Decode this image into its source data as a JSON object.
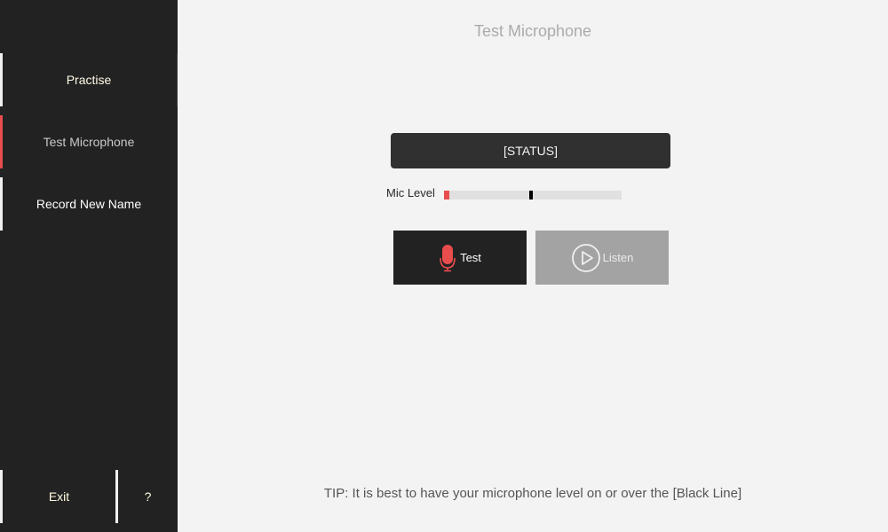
{
  "sidebar": {
    "items": [
      {
        "label": "Practise"
      },
      {
        "label": "Test Microphone",
        "active": true
      },
      {
        "label": "Record New Name"
      }
    ],
    "exit_label": "Exit",
    "help_label": "?"
  },
  "main": {
    "title": "Test Microphone",
    "status": "[STATUS]",
    "mic_level_label": "Mic Level",
    "mic_level_fraction": 0.03,
    "threshold_fraction": 0.48,
    "test_label": "Test",
    "listen_label": "Listen",
    "tip": "TIP: It is best to have your microphone level on or over the [Black Line]"
  },
  "colors": {
    "accent": "#e84c4c",
    "sidebar_bg": "#222222",
    "content_bg": "#f3f3f3",
    "disabled_button": "#a3a3a3"
  },
  "icons": {
    "test": "microphone-icon",
    "listen": "play-circle-icon"
  }
}
